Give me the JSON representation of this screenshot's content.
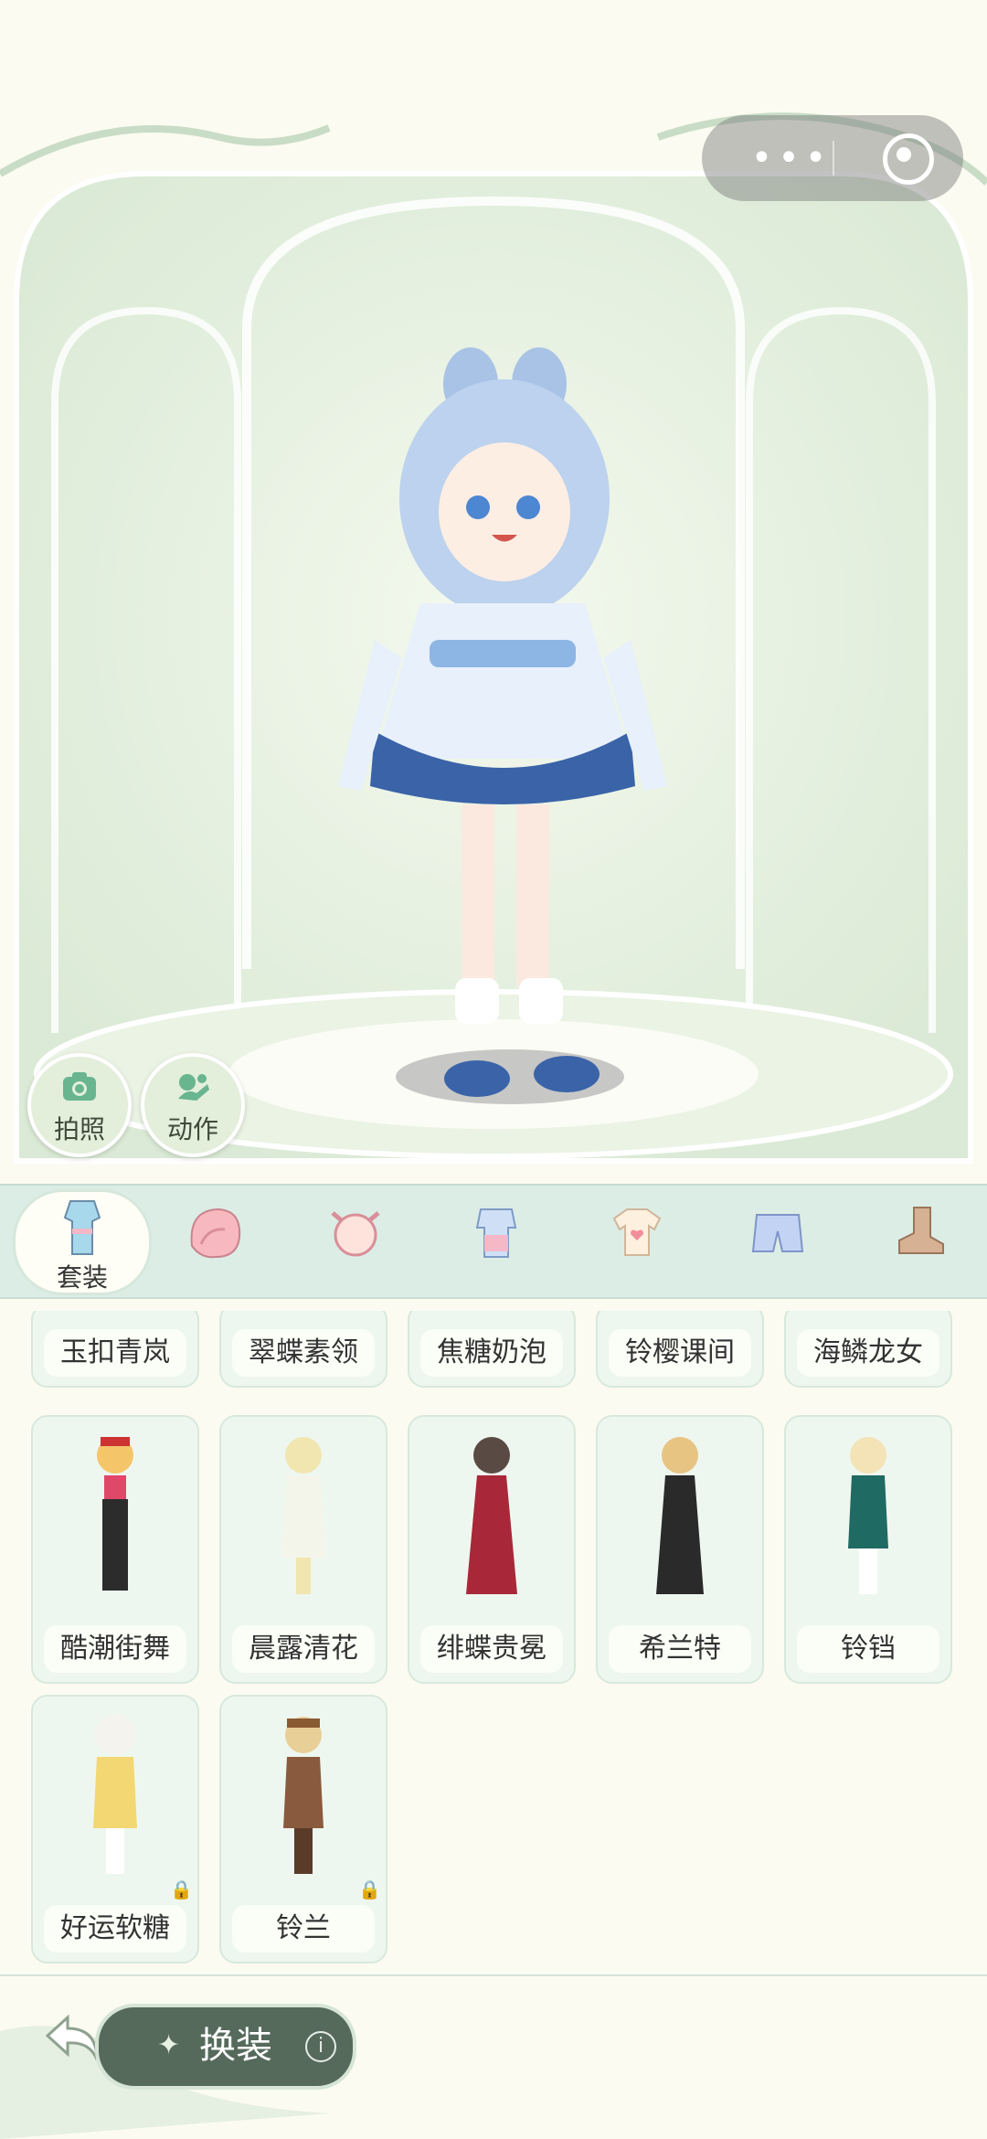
{
  "capsule": {
    "more_icon": "more-dots-icon",
    "close_icon": "target-icon"
  },
  "stage_buttons": [
    {
      "label": "拍照",
      "icon": "camera-icon"
    },
    {
      "label": "动作",
      "icon": "pose-icon"
    }
  ],
  "categories": [
    {
      "label": "套装",
      "icon": "outfit-icon",
      "active": true
    },
    {
      "label": "",
      "icon": "hair-icon",
      "active": false
    },
    {
      "label": "",
      "icon": "face-icon",
      "active": false
    },
    {
      "label": "",
      "icon": "dress-icon",
      "active": false
    },
    {
      "label": "",
      "icon": "top-icon",
      "active": false
    },
    {
      "label": "",
      "icon": "bottom-icon",
      "active": false
    },
    {
      "label": "",
      "icon": "shoe-icon",
      "active": false
    }
  ],
  "outfits_row1": [
    "玉扣青岚",
    "翠蝶素领",
    "焦糖奶泡",
    "铃樱课间",
    "海鳞龙女"
  ],
  "outfits_row2": [
    "酷潮街舞",
    "晨露清花",
    "绯蝶贵冕",
    "希兰特",
    "铃铛"
  ],
  "outfits_row3": [
    {
      "name": "好运软糖",
      "locked": true
    },
    {
      "name": "铃兰",
      "locked": true
    }
  ],
  "bottom": {
    "action_label": "换装",
    "back_icon": "back-arrow-icon",
    "info_icon": "info-icon"
  },
  "colors": {
    "background": "#fbfbf1",
    "category_bar": "#dcede6",
    "button_dark": "#566a5c",
    "card": "#eef7ef"
  }
}
